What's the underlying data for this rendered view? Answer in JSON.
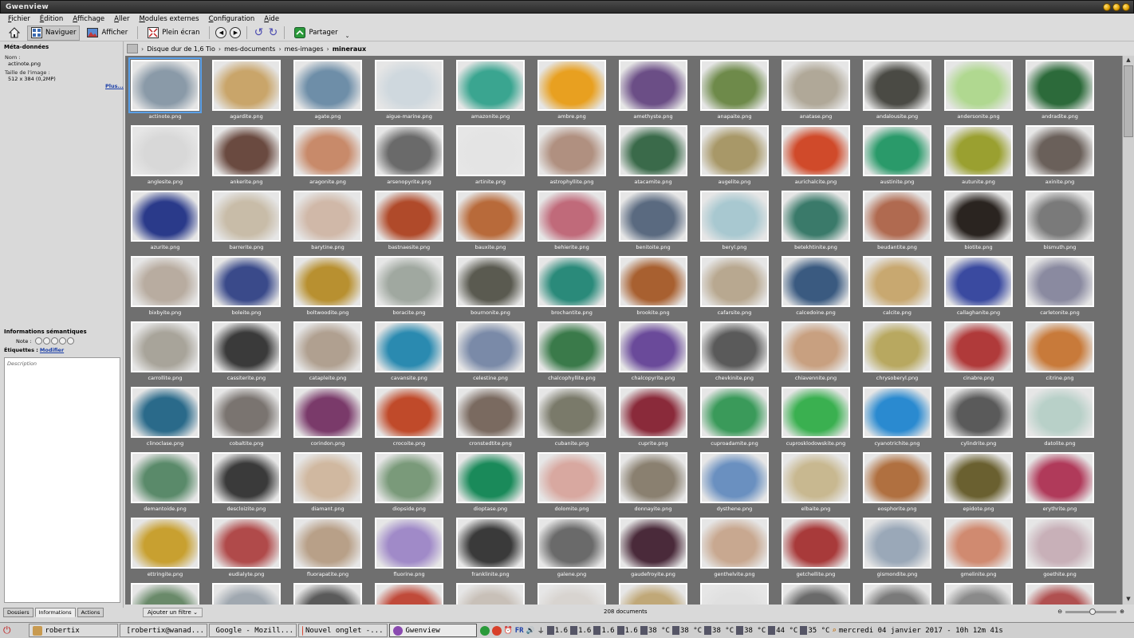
{
  "window": {
    "title": "Gwenview"
  },
  "menu": [
    "Fichier",
    "Édition",
    "Affichage",
    "Aller",
    "Modules externes",
    "Configuration",
    "Aide"
  ],
  "toolbar": {
    "browse": "Naviguer",
    "view": "Afficher",
    "fullscreen": "Plein écran",
    "share": "Partager"
  },
  "metadata": {
    "title": "Méta-données",
    "name_label": "Nom :",
    "name_value": "actinote.png",
    "size_label": "Taille de l'image :",
    "size_value": "512 x 384 (0,2MP)",
    "more": "Plus..."
  },
  "semantic": {
    "title": "Informations sémantiques",
    "rating_label": "Note :",
    "tags_label": "Étiquettes :",
    "tags_link": "Modifier",
    "description_placeholder": "Description"
  },
  "panel_tabs": [
    "Dossiers",
    "Informations",
    "Actions"
  ],
  "breadcrumb": [
    "Disque dur de 1,6 Tio",
    "mes-documents",
    "mes-images",
    "mineraux"
  ],
  "status": {
    "filter": "Ajouter un filtre",
    "count": "208 documents"
  },
  "thumbs": [
    {
      "n": "actinote.png",
      "c": "#8a9aa8"
    },
    {
      "n": "agardite.png",
      "c": "#c9a56a"
    },
    {
      "n": "agate.png",
      "c": "#6e8ea8"
    },
    {
      "n": "aigue-marine.png",
      "c": "#cfd8de"
    },
    {
      "n": "amazonite.png",
      "c": "#3aa590"
    },
    {
      "n": "ambre.png",
      "c": "#e8a020"
    },
    {
      "n": "amethyste.png",
      "c": "#6b4e86"
    },
    {
      "n": "anapaite.png",
      "c": "#6e8a4a"
    },
    {
      "n": "anatase.png",
      "c": "#b0a898"
    },
    {
      "n": "andalousite.png",
      "c": "#4a4a44"
    },
    {
      "n": "andersonite.png",
      "c": "#b0d890"
    },
    {
      "n": "andradite.png",
      "c": "#2c6a3a"
    },
    {
      "n": "anglesite.png",
      "c": "#d8d8d8"
    },
    {
      "n": "ankerite.png",
      "c": "#6a4a40"
    },
    {
      "n": "aragonite.png",
      "c": "#c88a6a"
    },
    {
      "n": "arsenopyrite.png",
      "c": "#6a6a6a"
    },
    {
      "n": "artinite.png",
      "c": "#e4e4e4"
    },
    {
      "n": "astrophyllite.png",
      "c": "#b09080"
    },
    {
      "n": "atacamite.png",
      "c": "#3a6a4a"
    },
    {
      "n": "augelite.png",
      "c": "#a89868"
    },
    {
      "n": "aurichalcite.png",
      "c": "#d04a2a"
    },
    {
      "n": "austinite.png",
      "c": "#2a9a6a"
    },
    {
      "n": "autunite.png",
      "c": "#9aa030"
    },
    {
      "n": "axinite.png",
      "c": "#6a605a"
    },
    {
      "n": "azurite.png",
      "c": "#2a3a8a"
    },
    {
      "n": "barrerite.png",
      "c": "#c8bca8"
    },
    {
      "n": "barytine.png",
      "c": "#d0b8a8"
    },
    {
      "n": "bastnaesite.png",
      "c": "#b04a2a"
    },
    {
      "n": "bauxite.png",
      "c": "#b86a3a"
    },
    {
      "n": "behierite.png",
      "c": "#c06a7a"
    },
    {
      "n": "benitoite.png",
      "c": "#5a6a80"
    },
    {
      "n": "beryl.png",
      "c": "#a8c8d0"
    },
    {
      "n": "betekhtinite.png",
      "c": "#3a7a6a"
    },
    {
      "n": "beudantite.png",
      "c": "#b06a50"
    },
    {
      "n": "biotite.png",
      "c": "#2a2420"
    },
    {
      "n": "bismuth.png",
      "c": "#7a7a7a"
    },
    {
      "n": "bixbyite.png",
      "c": "#b8aca0"
    },
    {
      "n": "boleite.png",
      "c": "#3a4a8a"
    },
    {
      "n": "boltwoodite.png",
      "c": "#b89030"
    },
    {
      "n": "boracite.png",
      "c": "#a0a8a0"
    },
    {
      "n": "bournonite.png",
      "c": "#5a5a50"
    },
    {
      "n": "brochantite.png",
      "c": "#2a8a7a"
    },
    {
      "n": "brookite.png",
      "c": "#a86030"
    },
    {
      "n": "cafarsite.png",
      "c": "#b8a890"
    },
    {
      "n": "calcedoine.png",
      "c": "#3a5a80"
    },
    {
      "n": "calcite.png",
      "c": "#c8a870"
    },
    {
      "n": "callaghanite.png",
      "c": "#3a4aa0"
    },
    {
      "n": "carletonite.png",
      "c": "#8a8aa0"
    },
    {
      "n": "carrollite.png",
      "c": "#a8a49a"
    },
    {
      "n": "cassiterite.png",
      "c": "#3a3a3a"
    },
    {
      "n": "catapleite.png",
      "c": "#b0a090"
    },
    {
      "n": "cavansite.png",
      "c": "#2a8ab0"
    },
    {
      "n": "celestine.png",
      "c": "#7a8aa8"
    },
    {
      "n": "chalcophyllite.png",
      "c": "#3a7a4a"
    },
    {
      "n": "chalcopyrite.png",
      "c": "#6a4a9a"
    },
    {
      "n": "chevkinite.png",
      "c": "#5a5a5a"
    },
    {
      "n": "chiavennite.png",
      "c": "#c8a080"
    },
    {
      "n": "chrysoberyl.png",
      "c": "#b8a860"
    },
    {
      "n": "cinabre.png",
      "c": "#b03a3a"
    },
    {
      "n": "citrine.png",
      "c": "#c87a3a"
    },
    {
      "n": "clinoclase.png",
      "c": "#2a6a8a"
    },
    {
      "n": "cobaltite.png",
      "c": "#7a7470"
    },
    {
      "n": "corindon.png",
      "c": "#7a3a6a"
    },
    {
      "n": "crocoite.png",
      "c": "#c04a2a"
    },
    {
      "n": "cronstedtite.png",
      "c": "#7a6a60"
    },
    {
      "n": "cubanite.png",
      "c": "#7a7a6a"
    },
    {
      "n": "cuprite.png",
      "c": "#8a2a3a"
    },
    {
      "n": "cuproadamite.png",
      "c": "#3a9a5a"
    },
    {
      "n": "cuprosklodowskite.png",
      "c": "#3ab050"
    },
    {
      "n": "cyanotrichite.png",
      "c": "#2a8ad0"
    },
    {
      "n": "cylindrite.png",
      "c": "#5a5a5a"
    },
    {
      "n": "datolite.png",
      "c": "#b8d0c8"
    },
    {
      "n": "demantoide.png",
      "c": "#5a8a6a"
    },
    {
      "n": "descloizite.png",
      "c": "#3a3a3a"
    },
    {
      "n": "diamant.png",
      "c": "#d0b8a0"
    },
    {
      "n": "diopside.png",
      "c": "#7a9a7a"
    },
    {
      "n": "dioptase.png",
      "c": "#1a8a5a"
    },
    {
      "n": "dolomite.png",
      "c": "#d8a8a0"
    },
    {
      "n": "donnayite.png",
      "c": "#8a8070"
    },
    {
      "n": "dysthene.png",
      "c": "#6a90c0"
    },
    {
      "n": "elbaite.png",
      "c": "#c8b890"
    },
    {
      "n": "eosphorite.png",
      "c": "#b07040"
    },
    {
      "n": "epidote.png",
      "c": "#6a6030"
    },
    {
      "n": "erythrite.png",
      "c": "#b03a5a"
    },
    {
      "n": "ettringite.png",
      "c": "#c8a030"
    },
    {
      "n": "eudialyte.png",
      "c": "#b04a4a"
    },
    {
      "n": "fluorapatite.png",
      "c": "#b8a088"
    },
    {
      "n": "fluorine.png",
      "c": "#a08ac8"
    },
    {
      "n": "franklinite.png",
      "c": "#3a3a3a"
    },
    {
      "n": "galene.png",
      "c": "#6a6a6a"
    },
    {
      "n": "gaudefroyite.png",
      "c": "#4a2a3a"
    },
    {
      "n": "genthelvite.png",
      "c": "#c8a890"
    },
    {
      "n": "getchellite.png",
      "c": "#a83a3a"
    },
    {
      "n": "gismondite.png",
      "c": "#9aa8b8"
    },
    {
      "n": "gmelinite.png",
      "c": "#d08a70"
    },
    {
      "n": "goethite.png",
      "c": "#c8b0b8"
    },
    {
      "n": "",
      "c": "#6a8a6a"
    },
    {
      "n": "",
      "c": "#a0a8b0"
    },
    {
      "n": "",
      "c": "#5a5a5a"
    },
    {
      "n": "",
      "c": "#c04a3a"
    },
    {
      "n": "",
      "c": "#c8c0b8"
    },
    {
      "n": "",
      "c": "#d8d4d0"
    },
    {
      "n": "",
      "c": "#c0a878"
    },
    {
      "n": "",
      "c": "#e0e0e0"
    },
    {
      "n": "",
      "c": "#6a6a6a"
    },
    {
      "n": "",
      "c": "#7a7a7a"
    },
    {
      "n": "",
      "c": "#8a8a8a"
    },
    {
      "n": "",
      "c": "#b05050"
    }
  ],
  "taskbar": {
    "tasks": [
      "robertix",
      "[robertix@wanad...",
      "Google - Mozill...",
      "Nouvel onglet -...",
      "Gwenview"
    ],
    "lang": "FR",
    "cpu": [
      "1.6",
      "1.6",
      "1.6",
      "1.6"
    ],
    "temps": [
      "38 °C",
      "38 °C",
      "38 °C",
      "38 °C",
      "44 °C",
      "35 °C"
    ],
    "clock": "mercredi 04 janvier 2017 - 10h 12m 41s"
  }
}
